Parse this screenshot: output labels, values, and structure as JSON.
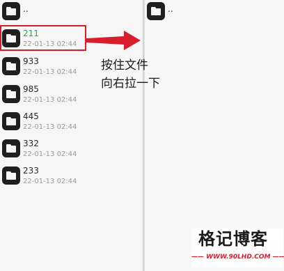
{
  "left_pane": {
    "parent_label": "..",
    "files": [
      {
        "name": "211",
        "date": "22-01-13 02:44",
        "selected": true
      },
      {
        "name": "933",
        "date": "22-01-13 02:44",
        "selected": false
      },
      {
        "name": "985",
        "date": "22-01-13 02:44",
        "selected": false
      },
      {
        "name": "445",
        "date": "22-01-13 02:44",
        "selected": false
      },
      {
        "name": "332",
        "date": "22-01-13 02:44",
        "selected": false
      },
      {
        "name": "233",
        "date": "22-01-13 02:44",
        "selected": false
      }
    ]
  },
  "annotation": {
    "line1": "按住文件",
    "line2": "向右拉一下",
    "color": "#d81e2c"
  },
  "watermark": {
    "title": "格记博客",
    "url": "—— WWW.90LHD.COM ——"
  },
  "colors": {
    "selected_text": "#3aa04a",
    "highlight": "#d81e2c",
    "folder_icon": "#1f1f1f"
  }
}
